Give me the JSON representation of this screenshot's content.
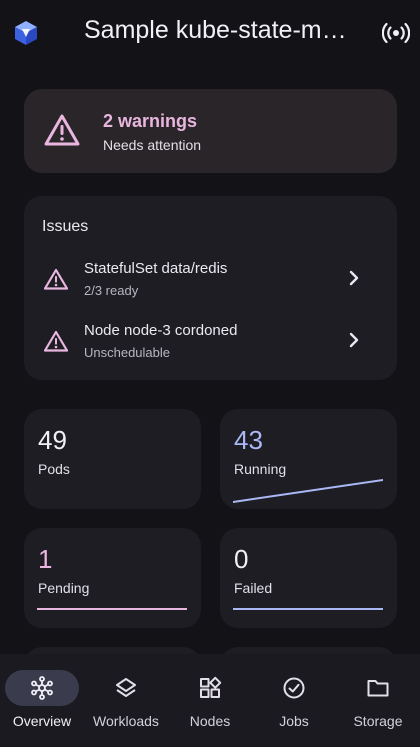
{
  "header": {
    "title": "Sample kube-state-m…",
    "logo_icon": "cube-logo-icon",
    "live_icon": "broadcast-icon"
  },
  "alert": {
    "title": "2 warnings",
    "subtitle": "Needs attention",
    "icon": "warning-icon",
    "color": "#e8b6de"
  },
  "issues": {
    "heading": "Issues",
    "items": [
      {
        "title": "StatefulSet data/redis",
        "subtitle": "2/3 ready",
        "icon": "warning-icon"
      },
      {
        "title": "Node node-3 cordoned",
        "subtitle": "Unschedulable",
        "icon": "warning-icon"
      }
    ]
  },
  "stats": [
    {
      "value": "49",
      "label": "Pods",
      "value_color": "#f2f0f6"
    },
    {
      "value": "43",
      "label": "Running",
      "value_color": "#aab9f5",
      "trend_color": "#aab9f5"
    },
    {
      "value": "1",
      "label": "Pending",
      "value_color": "#e8b6de",
      "trend_color": "#e8b6de"
    },
    {
      "value": "0",
      "label": "Failed",
      "value_color": "#f2f0f6",
      "trend_color": "#aab9f5"
    }
  ],
  "nav": {
    "active": "Overview",
    "items": [
      {
        "label": "Overview",
        "icon": "hub-icon"
      },
      {
        "label": "Workloads",
        "icon": "layers-icon"
      },
      {
        "label": "Nodes",
        "icon": "widgets-icon"
      },
      {
        "label": "Jobs",
        "icon": "check-circle-icon"
      },
      {
        "label": "Storage",
        "icon": "folder-icon"
      }
    ]
  },
  "colors": {
    "background": "#121217",
    "card": "#1e1d23",
    "warning_card": "#2a2529",
    "accent_pink": "#e8b6de",
    "accent_blue": "#aab9f5",
    "nav_active_pill": "#3a3c4d"
  }
}
